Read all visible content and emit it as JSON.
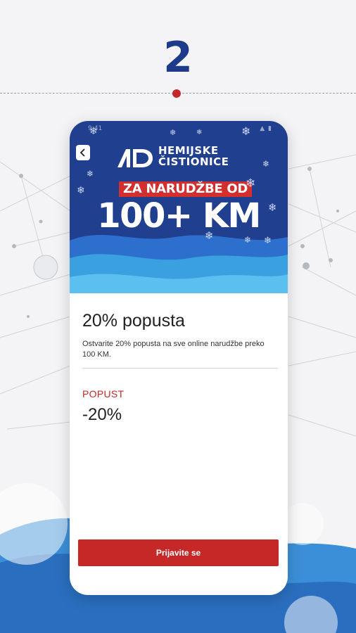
{
  "step": {
    "number": "2"
  },
  "status_bar": {
    "time": "9:41",
    "icons": "▲ ▮"
  },
  "banner": {
    "logo_mark": "AD",
    "logo_line1": "HEMIJSKE",
    "logo_line2": "ČISTIONICE",
    "promo_line1": "ZA NARUDŽBE OD",
    "promo_line2": "100+ KM",
    "snowflake_glyph": "❄"
  },
  "offer": {
    "title": "20% popusta",
    "description": "Ostvarite 20% popusta na sve online narudžbe preko 100 KM.",
    "discount_label": "POPUST",
    "discount_value": "-20%"
  },
  "actions": {
    "login_label": "Prijavite se"
  },
  "colors": {
    "brand_blue": "#213f8f",
    "accent_red": "#c62828",
    "wave_light": "#3aa0e0"
  },
  "icons": {
    "back": "chevron-left-icon",
    "snowflake": "snowflake-icon"
  }
}
